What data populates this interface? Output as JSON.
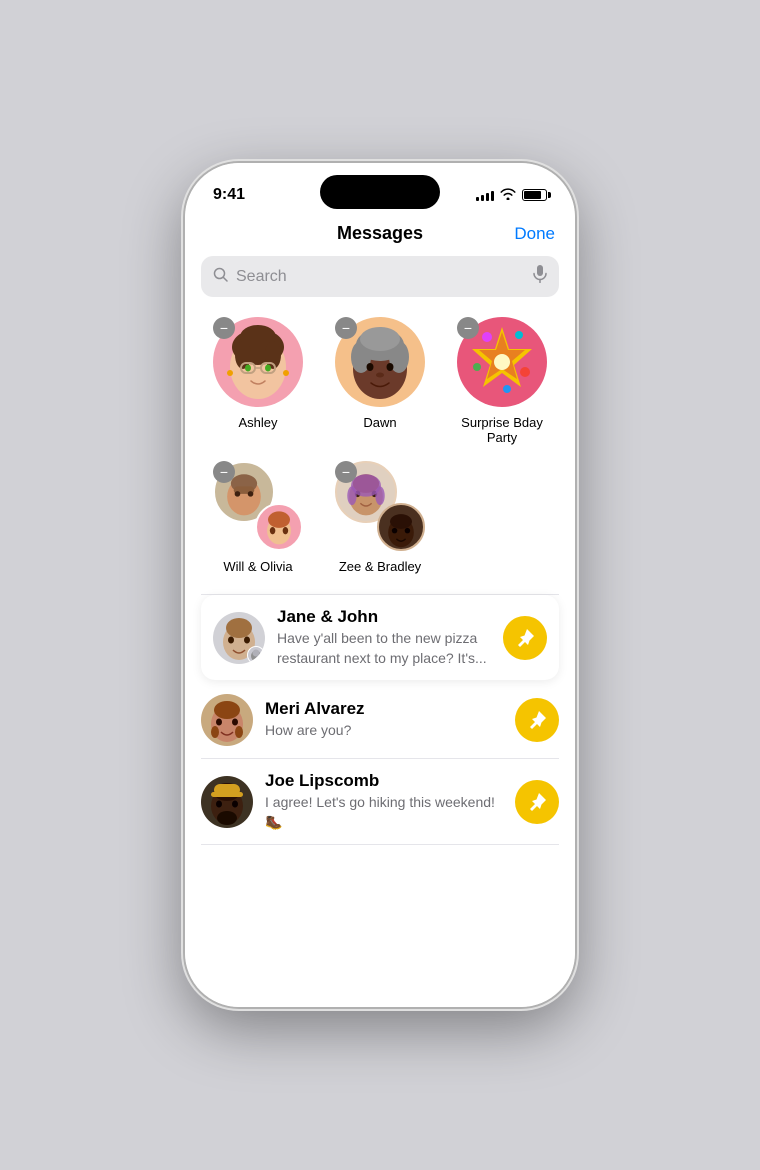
{
  "status_bar": {
    "time": "9:41",
    "signal": 4,
    "wifi": true,
    "battery": 80
  },
  "header": {
    "title": "Messages",
    "done_label": "Done"
  },
  "search": {
    "placeholder": "Search",
    "mic_icon": "mic-icon"
  },
  "pinned_contacts": [
    {
      "id": "ashley",
      "name": "Ashley",
      "avatar_type": "single",
      "bg_color": "pink",
      "emoji": "👩"
    },
    {
      "id": "dawn",
      "name": "Dawn",
      "avatar_type": "single",
      "bg_color": "peach",
      "emoji": "👩🏿"
    },
    {
      "id": "surprise-bday",
      "name": "Surprise Bday Party",
      "avatar_type": "single",
      "bg_color": "rose",
      "emoji": "🎊"
    },
    {
      "id": "will-olivia",
      "name": "Will & Olivia",
      "avatar_type": "group",
      "emoji1": "🧑",
      "emoji2": "👩"
    },
    {
      "id": "zee-bradley",
      "name": "Zee & Bradley",
      "avatar_type": "group",
      "emoji1": "👩",
      "emoji2": "🧑🏿"
    }
  ],
  "conversations": [
    {
      "id": "jane-john",
      "name": "Jane & John",
      "preview": "Have y'all been to the new pizza restaurant next to my place? It's...",
      "avatar_emoji": "👩",
      "avatar_bg": "conv-avatar-bg-1",
      "has_badge": true,
      "badge_emoji": "👦",
      "pinned": true,
      "first": true
    },
    {
      "id": "meri-alvarez",
      "name": "Meri Alvarez",
      "preview": "How are you?",
      "avatar_emoji": "👩🏽",
      "avatar_bg": "conv-avatar-bg-2",
      "has_badge": false,
      "pinned": true,
      "first": false
    },
    {
      "id": "joe-lipscomb",
      "name": "Joe Lipscomb",
      "preview": "I agree! Let's go hiking this weekend! 🥾",
      "avatar_emoji": "🧑🏿",
      "avatar_bg": "conv-avatar-bg-3",
      "has_badge": false,
      "pinned": true,
      "first": false
    }
  ],
  "icons": {
    "search": "🔍",
    "mic": "🎙",
    "remove": "−",
    "pin": "📌"
  }
}
